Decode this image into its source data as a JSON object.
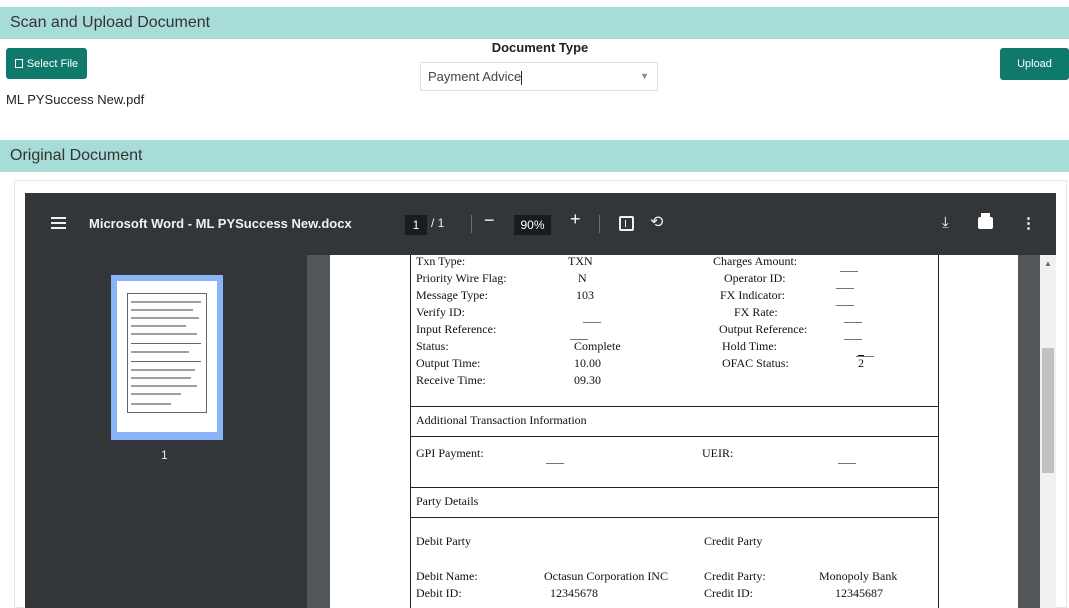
{
  "scan_section": {
    "title": "Scan and Upload Document",
    "select_file_label": "Select File",
    "file_name": "ML PYSuccess New.pdf",
    "document_type_label": "Document Type",
    "document_type_value": "Payment Advice",
    "upload_label": "Upload"
  },
  "original_section": {
    "title": "Original Document"
  },
  "viewer": {
    "doc_title": "Microsoft Word - ML PYSuccess New.docx",
    "current_page": "1",
    "total_pages": "/ 1",
    "zoom": "90%",
    "thumbnail_label": "1",
    "icons": [
      "menu-icon",
      "zoom-out-icon",
      "zoom-in-icon",
      "fit-page-icon",
      "rotate-icon",
      "download-icon",
      "print-icon",
      "more-icon"
    ]
  },
  "document": {
    "txn_rows": [
      {
        "label": "Txn Type:",
        "value": "TXN",
        "label2": "Charges Amount:",
        "value2": "___"
      },
      {
        "label": "Priority Wire Flag:",
        "value": "N",
        "label2": "Operator ID:",
        "value2": "___"
      },
      {
        "label": "Message Type:",
        "value": "103",
        "label2": "FX Indicator:",
        "value2": "___"
      },
      {
        "label": "Verify ID:",
        "value": "___",
        "label2": "FX Rate:",
        "value2": "___"
      },
      {
        "label": "Input Reference:",
        "value": "___",
        "label2": "Output Reference:",
        "value2": "___"
      },
      {
        "label": "Status:",
        "value": "Complete",
        "label2": "Hold Time:",
        "value2": "___"
      },
      {
        "label": "Output Time:",
        "value": "10.00",
        "label2": "OFAC Status:",
        "value2": "2"
      },
      {
        "label": "Receive Time:",
        "value": "09.30",
        "label2": "",
        "value2": ""
      }
    ],
    "additional_title": "Additional Transaction Information",
    "gpi_label": "GPI Payment:",
    "gpi_value": "___",
    "ueir_label": "UEIR:",
    "ueir_value": "___",
    "party_title": "Party Details",
    "debit_party_title": "Debit Party",
    "credit_party_title": "Credit Party",
    "party_rows": [
      {
        "label": "Debit Name:",
        "value": "Octasun Corporation INC",
        "label2": "Credit Party:",
        "value2": "Monopoly Bank"
      },
      {
        "label": "Debit ID:",
        "value": "12345678",
        "label2": "Credit ID:",
        "value2": "12345687"
      }
    ]
  },
  "colors": {
    "section_header_bg": "#a8dcd8",
    "button_teal": "#0f7a6c",
    "viewer_toolbar": "#323639",
    "viewer_background": "#525659",
    "thumbnail_highlight": "#8ab4f8"
  }
}
